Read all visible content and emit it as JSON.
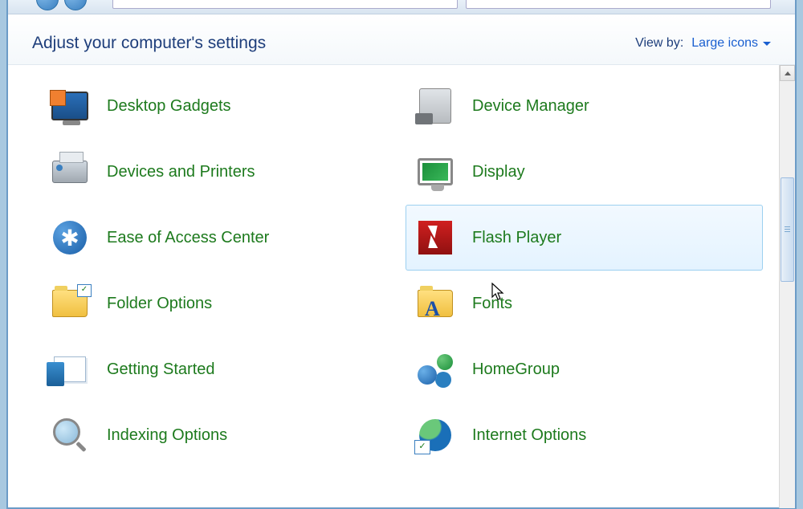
{
  "header": {
    "title": "Adjust your computer's settings",
    "viewby_label": "View by:",
    "viewby_value": "Large icons"
  },
  "items": [
    {
      "label": "Desktop Gadgets",
      "icon": "desktop-gadgets-icon"
    },
    {
      "label": "Device Manager",
      "icon": "device-manager-icon"
    },
    {
      "label": "Devices and Printers",
      "icon": "devices-printers-icon"
    },
    {
      "label": "Display",
      "icon": "display-icon"
    },
    {
      "label": "Ease of Access Center",
      "icon": "ease-of-access-icon"
    },
    {
      "label": "Flash Player",
      "icon": "flash-player-icon",
      "hover": true
    },
    {
      "label": "Folder Options",
      "icon": "folder-options-icon"
    },
    {
      "label": "Fonts",
      "icon": "fonts-icon"
    },
    {
      "label": "Getting Started",
      "icon": "getting-started-icon"
    },
    {
      "label": "HomeGroup",
      "icon": "homegroup-icon"
    },
    {
      "label": "Indexing Options",
      "icon": "indexing-options-icon"
    },
    {
      "label": "Internet Options",
      "icon": "internet-options-icon"
    }
  ]
}
